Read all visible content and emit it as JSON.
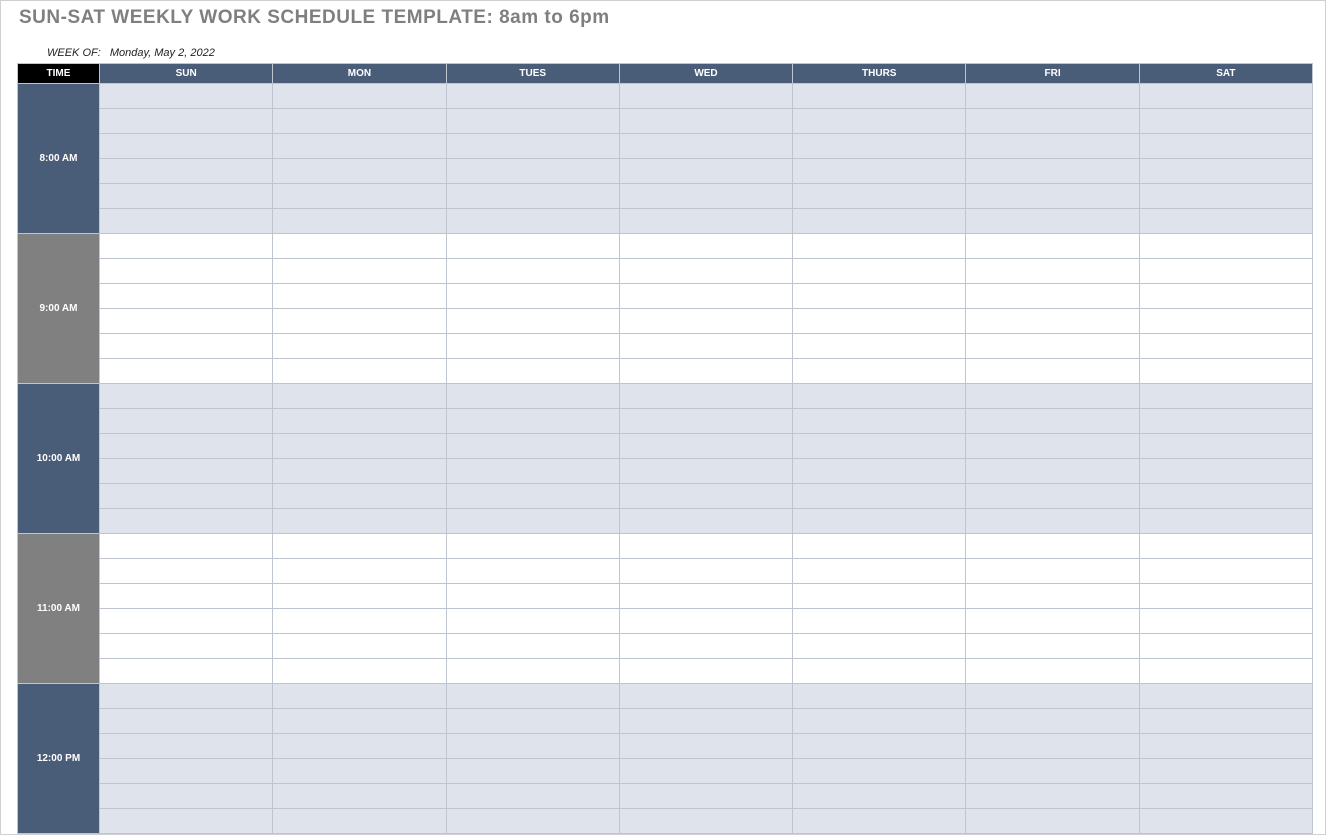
{
  "title": "SUN-SAT WEEKLY WORK SCHEDULE TEMPLATE: 8am to 6pm",
  "week_of_label": "WEEK OF:",
  "week_of_value": "Monday, May 2, 2022",
  "headers": {
    "time": "TIME",
    "days": [
      "SUN",
      "MON",
      "TUES",
      "WED",
      "THURS",
      "FRI",
      "SAT"
    ]
  },
  "hours": [
    {
      "label": "8:00 AM",
      "style": "navy",
      "slot_style": "tint"
    },
    {
      "label": "9:00 AM",
      "style": "gray",
      "slot_style": "white"
    },
    {
      "label": "10:00 AM",
      "style": "navy",
      "slot_style": "tint"
    },
    {
      "label": "11:00 AM",
      "style": "gray",
      "slot_style": "white"
    },
    {
      "label": "12:00 PM",
      "style": "navy",
      "slot_style": "tint"
    }
  ],
  "subslots_per_hour": 6
}
